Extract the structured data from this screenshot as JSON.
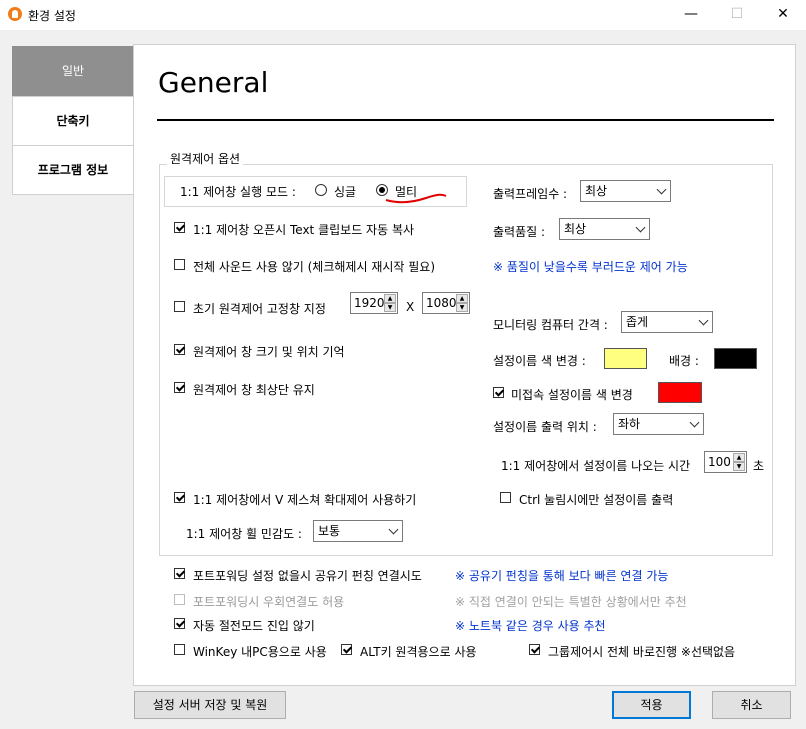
{
  "window": {
    "title": "환경 설정",
    "minimize_glyph": "—",
    "maximize_glyph": "☐",
    "close_glyph": "✕"
  },
  "sidebar": {
    "tabs": [
      {
        "label": "일반"
      },
      {
        "label": "단축키"
      },
      {
        "label": "프로그램 정보"
      }
    ]
  },
  "main": {
    "heading": "General",
    "group_label": "원격제어 옵션",
    "mode": {
      "label": "1:1 제어창 실행 모드 :",
      "single": "싱글",
      "multi": "멀티"
    },
    "left": {
      "clipboard": "1:1 제어창 오픈시 Text 클립보드 자동 복사",
      "sound": "전체 사운드 사용 않기 (체크해제시 재시작 필요)",
      "fixed_size": "초기 원격제어 고정창 지정",
      "width": "1920",
      "x": "X",
      "height": "1080",
      "remember": "원격제어 창 크기 및 위치 기억",
      "topmost": "원격제어 창 최상단 유지",
      "gesture": "1:1 제어창에서 V 제스쳐 확대제어 사용하기",
      "wheel_label": "1:1 제어창 휠 민감도 :",
      "wheel_value": "보통"
    },
    "right": {
      "fps_label": "출력프레임수 :",
      "fps_value": "최상",
      "quality_label": "출력품질 :",
      "quality_value": "최상",
      "quality_note": "※ 품질이 낮을수록 부러드운 제어 가능",
      "spacing_label": "모니터링 컴퓨터 간격 :",
      "spacing_value": "좁게",
      "name_color_label": "설정이름 색 변경 :",
      "bg_label": "배경 :",
      "disconnected_label": "미접속 설정이름 색 변경",
      "position_label": "설정이름 출력 위치 :",
      "position_value": "좌하",
      "time_label": "1:1 제어창에서 설정이름 나오는 시간",
      "time_value": "100",
      "time_unit": "초",
      "ctrl_label": "Ctrl 눌림시에만 설정이름 출력"
    },
    "bottom": {
      "forward": "포트포워딩 설정 없을시 공유기 펀칭 연결시도",
      "forward_note": "※ 공유기 펀칭을 통해 보다 빠른 연결 가능",
      "bypass": "포트포워딩시 우회연결도 허용",
      "bypass_note": "※ 직접 연결이 안되는 특별한 상황에서만 추천",
      "power": "자동 절전모드 진입 않기",
      "power_note": "※ 노트북 같은 경우 사용 추천",
      "winkey": "WinKey 내PC용으로 사용",
      "altkey": "ALT키 원격용으로 사용",
      "group": "그룹제어시 전체 바로진행 ※선택없음"
    }
  },
  "footer": {
    "backup": "설정 서버 저장 및 복원",
    "apply": "적용",
    "cancel": "취소"
  },
  "colors": {
    "name_color": "#ffff80",
    "bg_color": "#000000",
    "disconnected_color": "#ff0000",
    "annotation": "#e00000"
  }
}
